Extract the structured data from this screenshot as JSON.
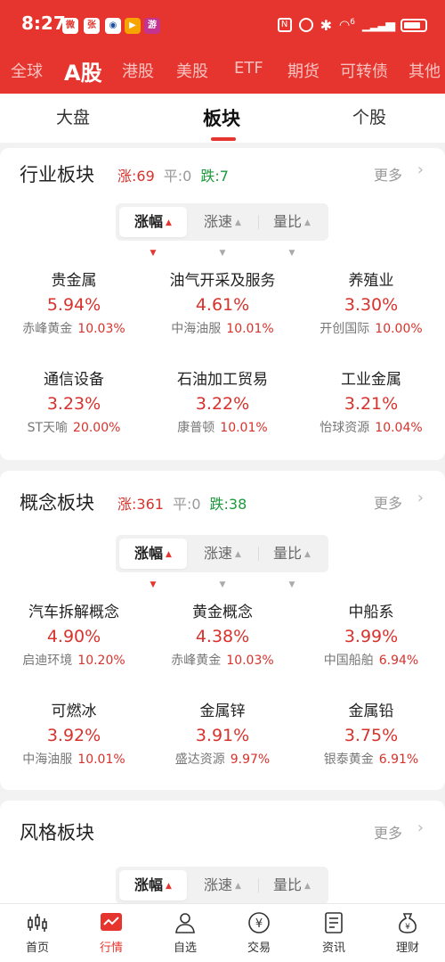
{
  "status_bar": {
    "time": "8:27",
    "notification_icons": [
      "weibo-icon",
      "app-zhang-icon",
      "compass-icon",
      "video-icon",
      "game-icon"
    ],
    "notif_labels": [
      "微",
      "张",
      "◉",
      "▶",
      "游"
    ],
    "network": "6"
  },
  "market_tabs": [
    "全球",
    "A股",
    "港股",
    "美股",
    "ETF",
    "期货",
    "可转债",
    "其他"
  ],
  "active_market_tab": "A股",
  "sub_tabs": [
    "大盘",
    "板块",
    "个股"
  ],
  "active_sub_tab": "板块",
  "sort_options": [
    "涨幅",
    "涨速",
    "量比"
  ],
  "industry": {
    "title": "行业板块",
    "up": "涨:69",
    "flat": "平:0",
    "down": "跌:7",
    "more": "更多",
    "sectors": [
      {
        "name": "贵金属",
        "pct": "5.94%",
        "leader": "赤峰黄金",
        "leader_pct": "10.03%"
      },
      {
        "name": "油气开采及服务",
        "pct": "4.61%",
        "leader": "中海油服",
        "leader_pct": "10.01%"
      },
      {
        "name": "养殖业",
        "pct": "3.30%",
        "leader": "开创国际",
        "leader_pct": "10.00%"
      },
      {
        "name": "通信设备",
        "pct": "3.23%",
        "leader": "ST天喻",
        "leader_pct": "20.00%"
      },
      {
        "name": "石油加工贸易",
        "pct": "3.22%",
        "leader": "康普顿",
        "leader_pct": "10.01%"
      },
      {
        "name": "工业金属",
        "pct": "3.21%",
        "leader": "怡球资源",
        "leader_pct": "10.04%"
      }
    ]
  },
  "concept": {
    "title": "概念板块",
    "up": "涨:361",
    "flat": "平:0",
    "down": "跌:38",
    "more": "更多",
    "sectors": [
      {
        "name": "汽车拆解概念",
        "pct": "4.90%",
        "leader": "启迪环境",
        "leader_pct": "10.20%"
      },
      {
        "name": "黄金概念",
        "pct": "4.38%",
        "leader": "赤峰黄金",
        "leader_pct": "10.03%"
      },
      {
        "name": "中船系",
        "pct": "3.99%",
        "leader": "中国船舶",
        "leader_pct": "6.94%"
      },
      {
        "name": "可燃冰",
        "pct": "3.92%",
        "leader": "中海油服",
        "leader_pct": "10.01%"
      },
      {
        "name": "金属锌",
        "pct": "3.91%",
        "leader": "盛达资源",
        "leader_pct": "9.97%"
      },
      {
        "name": "金属铅",
        "pct": "3.75%",
        "leader": "银泰黄金",
        "leader_pct": "6.91%"
      }
    ]
  },
  "style": {
    "title": "风格板块",
    "more": "更多"
  },
  "bottom_nav": [
    {
      "label": "首页",
      "icon": "candlestick-icon"
    },
    {
      "label": "行情",
      "icon": "chart-trend-icon"
    },
    {
      "label": "自选",
      "icon": "person-icon"
    },
    {
      "label": "交易",
      "icon": "yen-coin-icon"
    },
    {
      "label": "资讯",
      "icon": "document-icon"
    },
    {
      "label": "理财",
      "icon": "money-bag-icon"
    }
  ],
  "active_nav": "行情",
  "colors": {
    "brand_red": "#e5352e",
    "up_red": "#d8322c",
    "down_green": "#1b9a3a"
  }
}
